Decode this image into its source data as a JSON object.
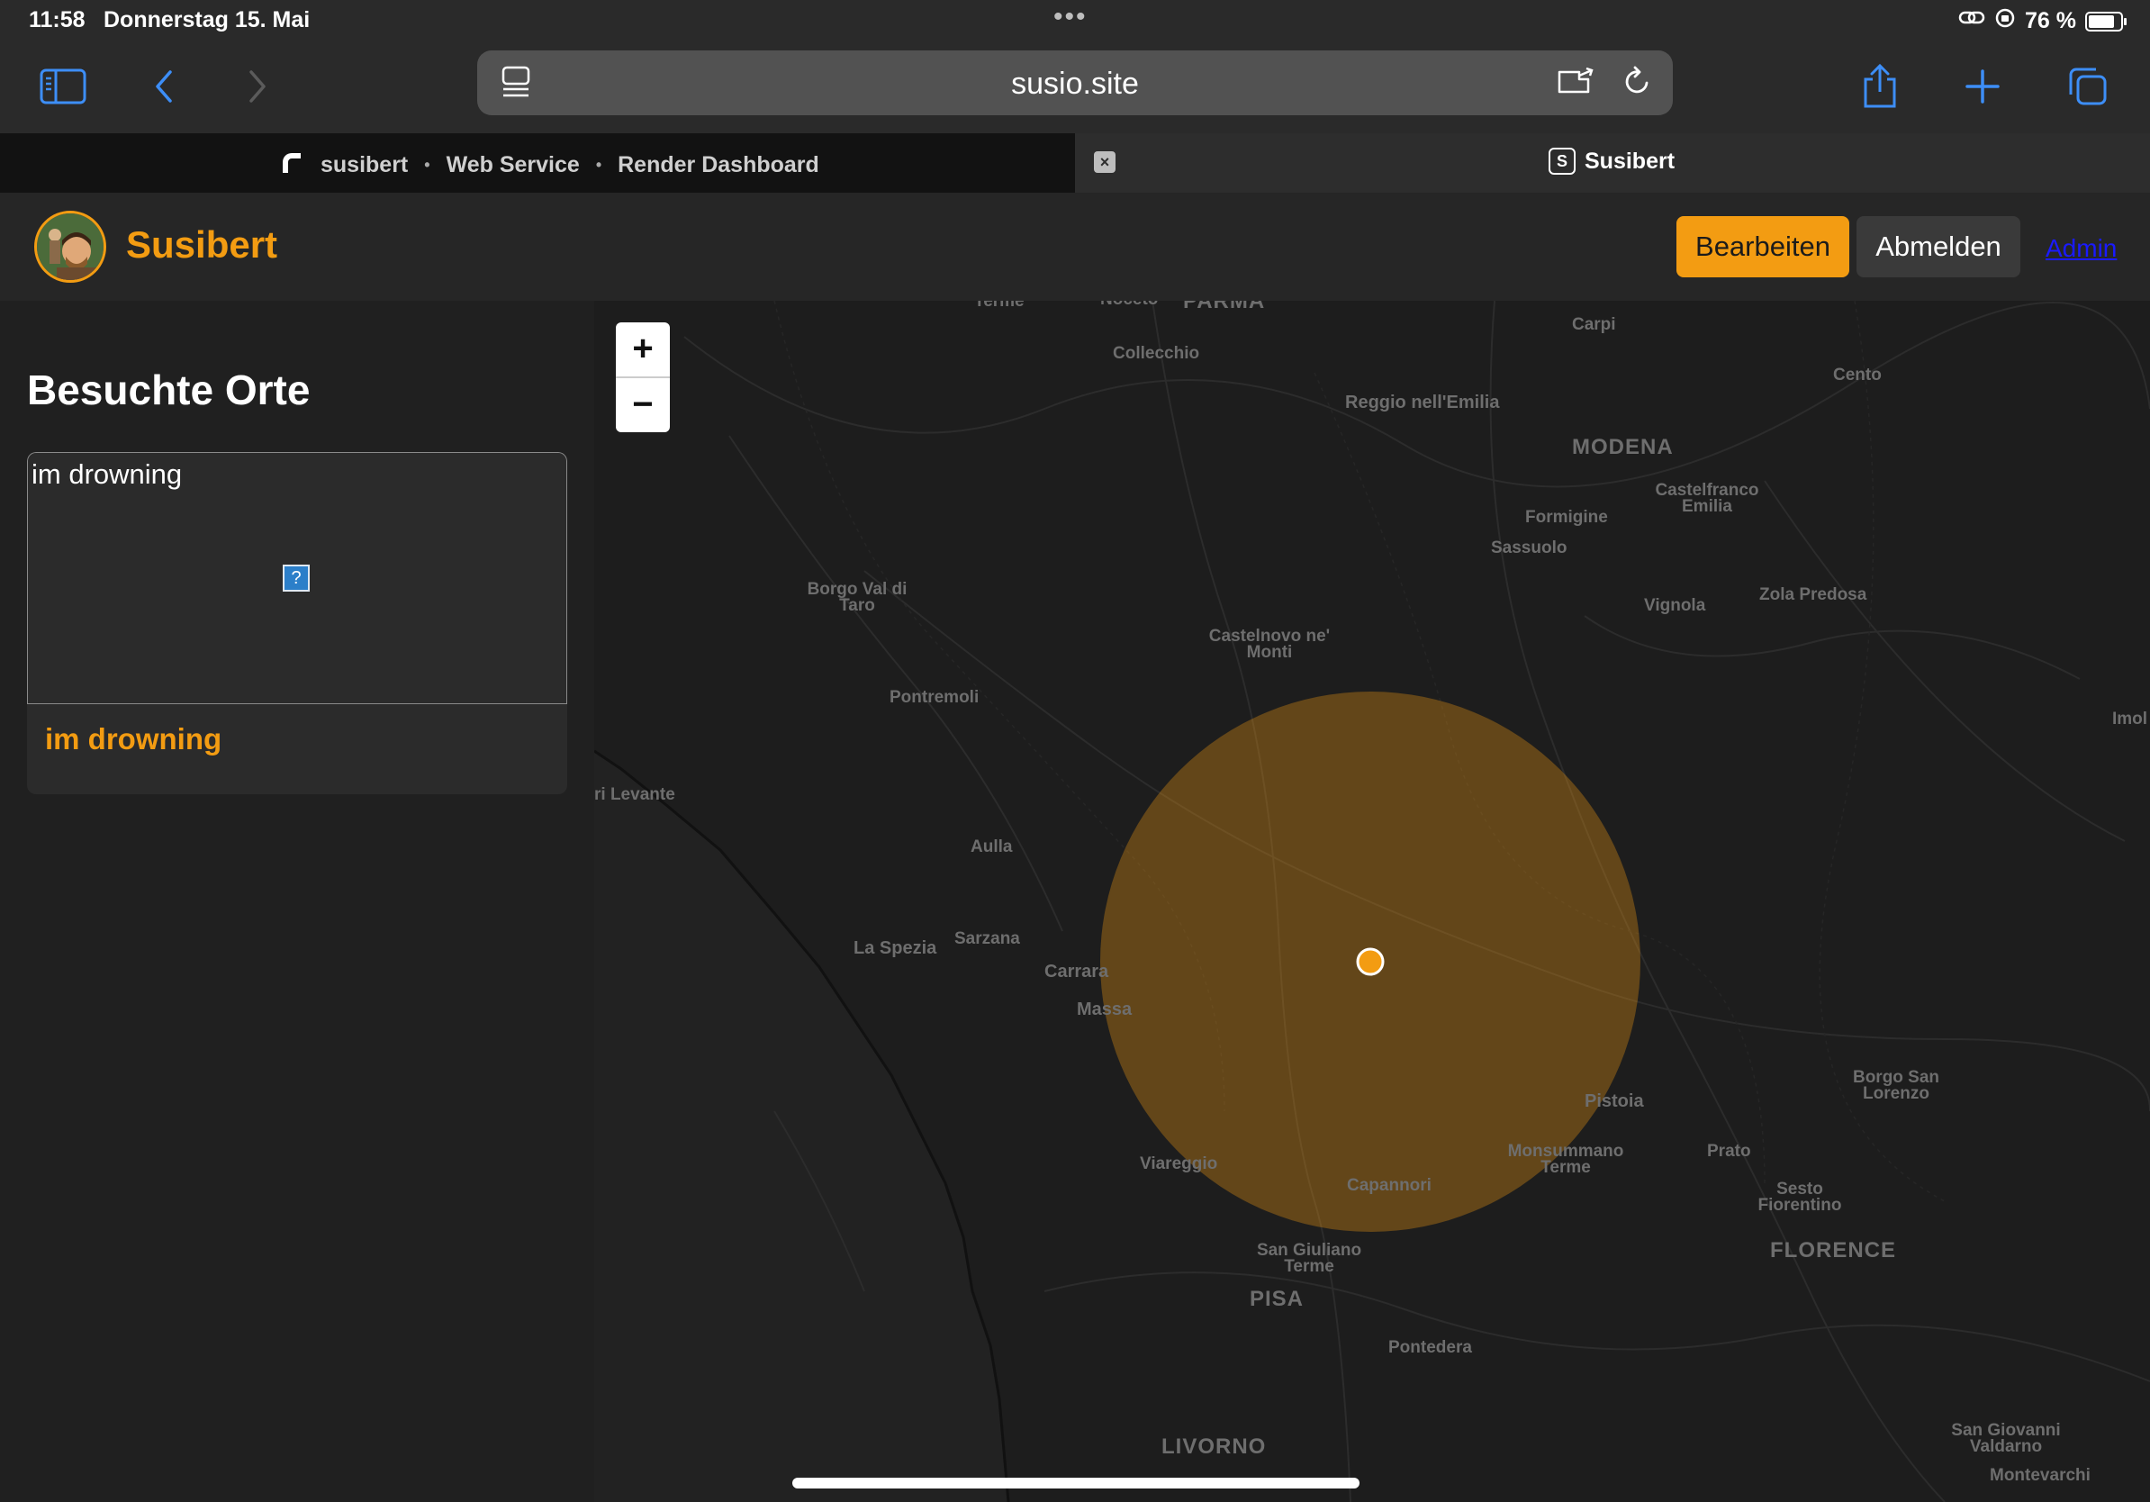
{
  "status_bar": {
    "time": "11:58",
    "date": "Donnerstag 15. Mai",
    "battery": "76 %",
    "battery_level": 0.76
  },
  "browser": {
    "url": "susio.site",
    "tabs": [
      {
        "parts": [
          "susibert",
          "Web Service",
          "Render Dashboard"
        ]
      },
      {
        "title": "Susibert",
        "favicon_letter": "S"
      }
    ]
  },
  "header": {
    "brand": "Susibert",
    "edit_label": "Bearbeiten",
    "logout_label": "Abmelden",
    "admin_label": "Admin"
  },
  "sidebar": {
    "title": "Besuchte Orte",
    "places": [
      {
        "image_alt": "im drowning",
        "name": "im drowning"
      }
    ]
  },
  "map": {
    "zoom_in": "+",
    "zoom_out": "−",
    "accent": "#f39c12",
    "labels": [
      "Terme",
      "Noceto",
      "PARMA",
      "Carpi",
      "Collecchio",
      "Cento",
      "Reggio nell'Emilia",
      "MODENA",
      "Castelfranco Emilia",
      "Formigine",
      "Sassuolo",
      "Borgo Val di Taro",
      "Vignola",
      "Zola Predosa",
      "Castelnovo ne' Monti",
      "Pontremoli",
      "Imol",
      "ri Levante",
      "Aulla",
      "La Spezia",
      "Sarzana",
      "Carrara",
      "Massa",
      "Pistoia",
      "Borgo San Lorenzo",
      "Viareggio",
      "Monsummano Terme",
      "Prato",
      "Capannori",
      "Sesto Fiorentino",
      "FLORENCE",
      "San Giuliano Terme",
      "PISA",
      "Pontedera",
      "LIVORNO",
      "San Giovanni Valdarno",
      "Montevarchi"
    ]
  }
}
